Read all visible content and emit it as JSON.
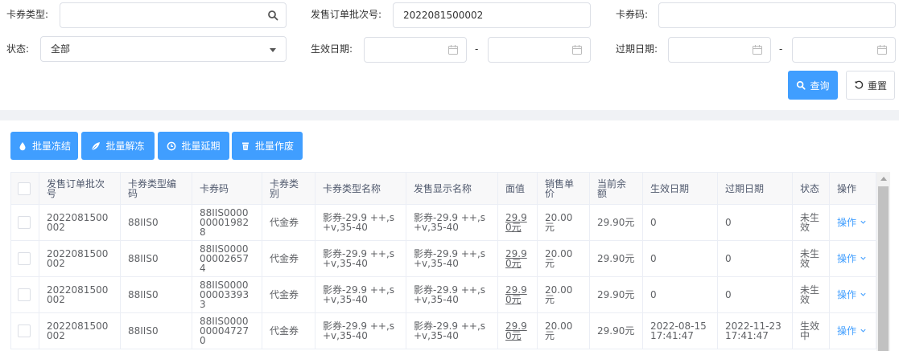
{
  "filters": {
    "card_type": {
      "label": "卡券类型:",
      "value": ""
    },
    "order_batch": {
      "label": "发售订单批次号:",
      "value": "2022081500002"
    },
    "card_code": {
      "label": "卡券码:",
      "value": ""
    },
    "status": {
      "label": "状态:",
      "value": "全部"
    },
    "effective_date": {
      "label": "生效日期:",
      "separator": "-"
    },
    "expire_date": {
      "label": "过期日期:",
      "separator": "-"
    },
    "query_label": "查询",
    "reset_label": "重置"
  },
  "batch_actions": [
    {
      "label": "批量冻结",
      "icon": "drop-icon"
    },
    {
      "label": "批量解冻",
      "icon": "leaf-icon"
    },
    {
      "label": "批量延期",
      "icon": "clock-icon"
    },
    {
      "label": "批量作废",
      "icon": "trash-icon"
    }
  ],
  "table": {
    "columns": [
      "发售订单批次号",
      "卡券类型编码",
      "卡券码",
      "卡券类别",
      "卡券类型名称",
      "发售显示名称",
      "面值",
      "销售单价",
      "当前余额",
      "生效日期",
      "过期日期",
      "状态",
      "操作"
    ],
    "rows": [
      {
        "order": "2022081500002",
        "type_code": "88IIS0",
        "code": "88IIS0000000019828",
        "category": "代金券",
        "type_name": "影券-29.9 ++,s+v,35-40",
        "display_name": "影券-29.9 ++,s+v,35-40",
        "face": "29.90元",
        "price": "20.00元",
        "balance": "29.90元",
        "start": "0",
        "end": "0",
        "status": "未生效",
        "op": "操作"
      },
      {
        "order": "2022081500002",
        "type_code": "88IIS0",
        "code": "88IIS0000000026574",
        "category": "代金券",
        "type_name": "影券-29.9 ++,s+v,35-40",
        "display_name": "影券-29.9 ++,s+v,35-40",
        "face": "29.90元",
        "price": "20.00元",
        "balance": "29.90元",
        "start": "0",
        "end": "0",
        "status": "未生效",
        "op": "操作"
      },
      {
        "order": "2022081500002",
        "type_code": "88IIS0",
        "code": "88IIS0000000033933",
        "category": "代金券",
        "type_name": "影券-29.9 ++,s+v,35-40",
        "display_name": "影券-29.9 ++,s+v,35-40",
        "face": "29.90元",
        "price": "20.00元",
        "balance": "29.90元",
        "start": "0",
        "end": "0",
        "status": "未生效",
        "op": "操作"
      },
      {
        "order": "2022081500002",
        "type_code": "88IIS0",
        "code": "88IIS0000000047270",
        "category": "代金券",
        "type_name": "影券-29.9 ++,s+v,35-40",
        "display_name": "影券-29.9 ++,s+v,35-40",
        "face": "29.90元",
        "price": "20.00元",
        "balance": "29.90元",
        "start": "2022-08-15 17:41:47",
        "end": "2022-11-23 17:41:47",
        "status": "生效中",
        "op": "操作"
      }
    ]
  },
  "colors": {
    "primary": "#409eff",
    "border": "#dcdfe6",
    "header_bg": "#f8f8f9"
  }
}
